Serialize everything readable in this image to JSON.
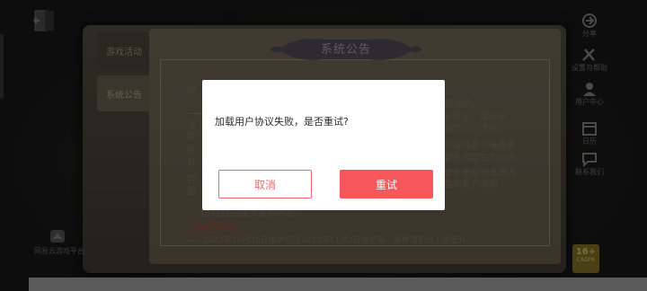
{
  "background": {
    "tabs": [
      {
        "label": "游戏活动"
      },
      {
        "label": "系统公告"
      }
    ],
    "notice_title": "系统公告",
    "notice_lines": [
      {
        "text": "致"
      },
      {
        "text": "服维护。"
      },
      {
        "text": "护状态，届时各"
      },
      {
        "text": "自定义、活动、"
      },
      {
        "text": "位"
      },
      {
        "text": "推"
      },
      {
        "text": "新"
      },
      {
        "text": "有"
      },
      {
        "text": "容"
      },
      {
        "text": "图"
      },
      {
        "text": "前游戏客户端再重"
      },
      {
        "text": "更新内容在内的所"
      },
      {
        "text": "求未更新到本周内"
      },
      {
        "text": "重启客户端后"
      },
      {
        "text": "10月26日版本更新内容。"
      },
      {
        "text": "【赛季冲刺】"
      },
      {
        "text": "——2023年10月26日维护后至2023年11月2日维护前，周推理积分上限提升"
      }
    ],
    "right_column": [
      {
        "label": "分享",
        "icon": "share-icon"
      },
      {
        "label": "设置与帮助",
        "icon": "tools-icon"
      },
      {
        "label": "用户中心",
        "icon": "user-icon"
      },
      {
        "label": "日历",
        "icon": "calendar-icon"
      },
      {
        "label": "联系我们",
        "icon": "message-icon"
      }
    ],
    "age_rating": {
      "value": "16+",
      "caption": "CADPA"
    },
    "bottom_left_label": "网易云游戏平台"
  },
  "dialog": {
    "message": "加载用户协议失败，是否重试?",
    "cancel_label": "取消",
    "retry_label": "重试"
  },
  "colors": {
    "accent": "#f5575a",
    "cancel_border": "#f0686a",
    "dialog_bg": "#ffffff"
  }
}
